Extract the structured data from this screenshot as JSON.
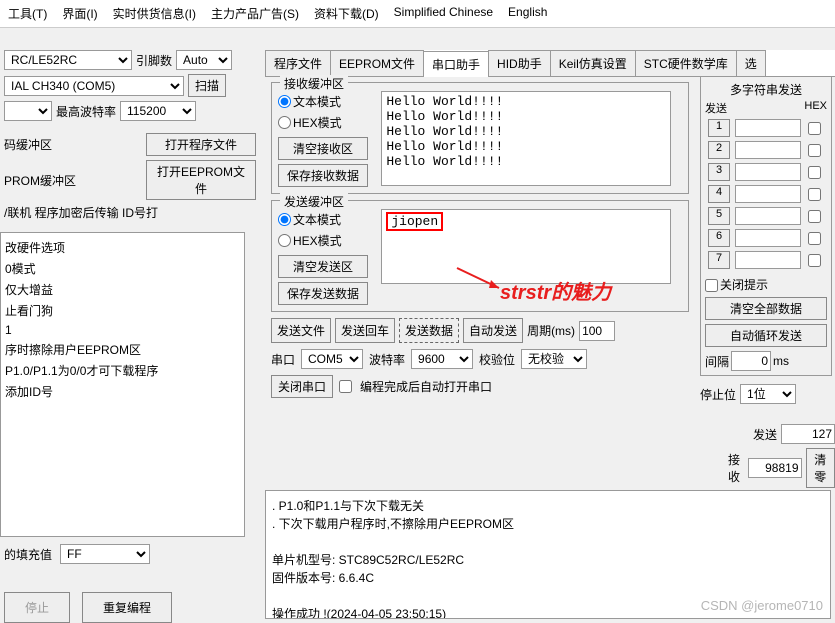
{
  "menu": [
    "工具(T)",
    "界面(I)",
    "实时供货信息(I)",
    "主力产品广告(S)",
    "资料下载(D)",
    "Simplified Chinese",
    "English"
  ],
  "topleft": {
    "chip": "RC/LE52RC",
    "pin_label": "引脚数",
    "pin_value": "Auto",
    "port": "IAL CH340 (COM5)",
    "scan": "扫描",
    "baud_label": "最高波特率",
    "baud_value": "115200",
    "buf_label": "码缓冲区",
    "open_prog": "打开程序文件",
    "eeprom_buf": "PROM缓冲区",
    "open_eeprom": "打开EEPROM文件",
    "row4": "/联机  程序加密后传输  ID号打"
  },
  "left_list": [
    "改硬件选项",
    "0模式",
    "仅大增益",
    "止看门狗",
    "1",
    "序时擦除用户EEPROM区",
    "P1.0/P1.1为0/0才可下载程序",
    "添加ID号"
  ],
  "fill": {
    "label": "的填充值",
    "value": "FF"
  },
  "bottom": {
    "stop": "停止",
    "reprog": "重复编程"
  },
  "tabs": [
    "程序文件",
    "EEPROM文件",
    "串口助手",
    "HID助手",
    "Keil仿真设置",
    "STC硬件数学库",
    "选"
  ],
  "active_tab": 2,
  "rx": {
    "legend": "接收缓冲区",
    "text_mode": "文本模式",
    "hex_mode": "HEX模式",
    "clear": "清空接收区",
    "save": "保存接收数据",
    "content": "Hello World!!!!\nHello World!!!!\nHello World!!!!\nHello World!!!!\nHello World!!!!"
  },
  "tx": {
    "legend": "发送缓冲区",
    "text_mode": "文本模式",
    "hex_mode": "HEX模式",
    "clear": "清空发送区",
    "save": "保存发送数据",
    "content": "jiopen"
  },
  "sendrow": {
    "file": "发送文件",
    "cr": "发送回车",
    "send": "发送数据",
    "auto": "自动发送",
    "period_lbl": "周期(ms)",
    "period": "100"
  },
  "serial": {
    "port_lbl": "串口",
    "port": "COM5",
    "baud_lbl": "波特率",
    "baud": "9600",
    "parity_lbl": "校验位",
    "parity": "无校验",
    "stop_lbl": "停止位",
    "stop": "1位",
    "close": "关闭串口",
    "after_prog": "编程完成后自动打开串口"
  },
  "right": {
    "legend": "多字符串发送",
    "send_hdr": "发送",
    "hex_hdr": "HEX",
    "rows": [
      "1",
      "2",
      "3",
      "4",
      "5",
      "6",
      "7"
    ],
    "close_hint": "关闭提示",
    "clear_all": "清空全部数据",
    "auto_loop": "自动循环发送",
    "gap_lbl": "间隔",
    "gap": "0",
    "ms": "ms"
  },
  "stats": {
    "send_lbl": "发送",
    "send": "127",
    "recv_lbl": "接收",
    "recv": "98819",
    "clear": "清零"
  },
  "log": {
    "l1": ". P1.0和P1.1与下次下载无关",
    "l2": ". 下次下载用户程序时,不擦除用户EEPROM区",
    "l3": "单片机型号: STC89C52RC/LE52RC",
    "l4": "固件版本号: 6.6.4C",
    "l5": "操作成功 !(2024-04-05 23:50:15)"
  },
  "annotation": "strstr的魅力",
  "watermark": "CSDN @jerome0710"
}
